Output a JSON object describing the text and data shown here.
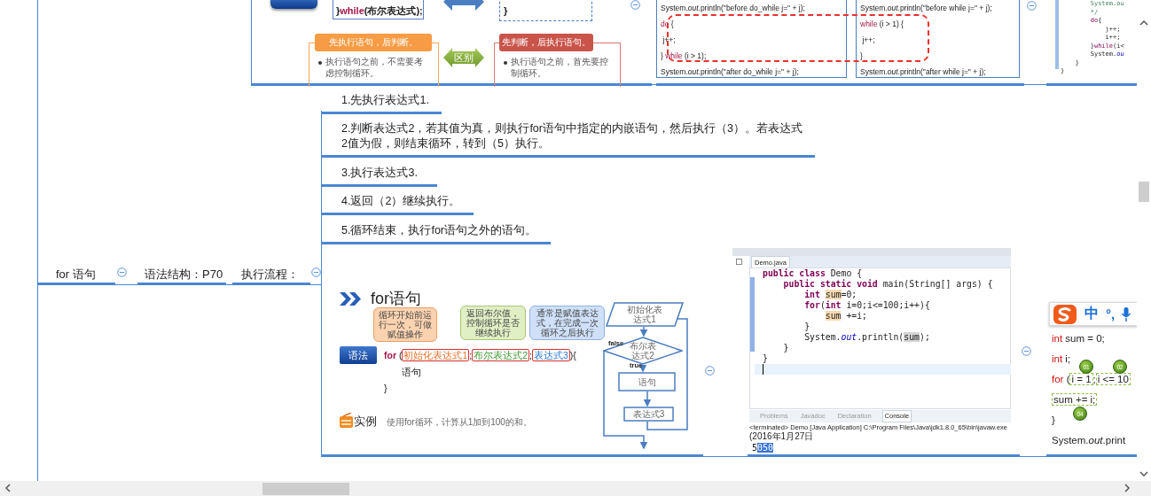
{
  "top_branch": {
    "loop_compare_slide": {
      "code_tail": [
        {
          "text": "}",
          "kind": "plain"
        },
        {
          "text": "while",
          "kind": "keyword"
        },
        {
          "text": "(布尔表达式);",
          "kind": "plain"
        }
      ],
      "block_end": "}",
      "do_while_heading": "先执行语句，后判断。",
      "do_while_note": "执行语句之前，不需要考虑控制循环。",
      "difference_label": "区别",
      "while_heading": "先判断，后执行语句。",
      "while_note": "执行语句之前，首先要控制循环。"
    },
    "code_compare": {
      "do_while_code": [
        [
          {
            "text": "System.",
            "kind": "plain"
          },
          {
            "text": "out",
            "kind": "italic"
          },
          {
            "text": ".println(\"before do_while j=\" + j);",
            "kind": "plain"
          }
        ],
        [
          {
            "text": "do",
            "kind": "keyword"
          },
          {
            "text": " {",
            "kind": "plain"
          }
        ],
        [
          {
            "text": " j++;",
            "kind": "plain"
          }
        ],
        [
          {
            "text": "} ",
            "kind": "plain"
          },
          {
            "text": "while",
            "kind": "keyword"
          },
          {
            "text": " (i > 1);",
            "kind": "plain"
          }
        ],
        [
          {
            "text": "System.",
            "kind": "plain"
          },
          {
            "text": "out",
            "kind": "italic"
          },
          {
            "text": ".println(\"after do_while j=\" + j);",
            "kind": "plain"
          }
        ]
      ],
      "while_code": [
        [
          {
            "text": "System.",
            "kind": "plain"
          },
          {
            "text": "out",
            "kind": "italic"
          },
          {
            "text": ".println(\"before while j=\" + j);",
            "kind": "plain"
          }
        ],
        [
          {
            "text": "while",
            "kind": "keyword"
          },
          {
            "text": " (i > 1) {",
            "kind": "plain"
          }
        ],
        [
          {
            "text": " j++;",
            "kind": "plain"
          }
        ],
        [
          {
            "text": "}",
            "kind": "plain"
          }
        ],
        [
          {
            "text": "System.",
            "kind": "plain"
          },
          {
            "text": "out",
            "kind": "italic"
          },
          {
            "text": ".println(\"after while j=\" + j);",
            "kind": "plain"
          }
        ]
      ]
    },
    "code_fragment": [
      [
        {
          "text": "        System.ou",
          "kind": "comment"
        }
      ],
      [
        {
          "text": "        */",
          "kind": "comment"
        }
      ],
      [
        {
          "text": "        do",
          "kind": "keyword"
        },
        {
          "text": "{",
          "kind": "plain"
        }
      ],
      [
        {
          "text": "            j++;",
          "kind": "plain"
        }
      ],
      [
        {
          "text": "            i++;",
          "kind": "plain"
        }
      ],
      [
        {
          "text": "        }",
          "kind": "plain"
        },
        {
          "text": "while",
          "kind": "keyword"
        },
        {
          "text": "(i<",
          "kind": "plain"
        }
      ],
      [
        {
          "text": "        System.",
          "kind": "plain"
        },
        {
          "text": "ou",
          "kind": "field"
        }
      ],
      [
        {
          "text": "    }",
          "kind": "plain"
        }
      ],
      [
        {
          "text": "}",
          "kind": "plain"
        }
      ]
    ]
  },
  "root": {
    "label": "for  语句"
  },
  "syntax": {
    "label": "语法结构：P70"
  },
  "flow": {
    "label": "执行流程：",
    "steps": [
      {
        "text": "1.先执行表达式1."
      },
      {
        "text": "2.判断表达式2，若其值为真，则执行for语句中指定的内嵌语句，然后执行（3）。若表达式2值为假，则结束循环，转到（5）执行。"
      },
      {
        "text": "3.执行表达式3."
      },
      {
        "text": "4.返回（2）继续执行。"
      },
      {
        "text": "5.循环结束，执行for语句之外的语句。"
      }
    ],
    "for_slide": {
      "title": "for语句",
      "callouts": [
        {
          "text": "循环开始前运行一次，可做赋值操作",
          "kind": "init"
        },
        {
          "text": "返回布尔值，控制循环是否继续执行",
          "kind": "cond"
        },
        {
          "text": "通常是赋值表达式，在完成一次循环之后执行",
          "kind": "step"
        }
      ],
      "syntax_button": "语法",
      "for_line": [
        {
          "text": "for",
          "kind": "keyword"
        },
        {
          "text": " (",
          "kind": "plain"
        },
        {
          "text": "初始化表达式1",
          "kind": "init"
        },
        {
          "text": ";",
          "kind": "plain"
        },
        {
          "text": "布尔表达式2",
          "kind": "cond"
        },
        {
          "text": ";",
          "kind": "plain"
        },
        {
          "text": "表达式3",
          "kind": "step"
        },
        {
          "text": "){",
          "kind": "plain"
        }
      ],
      "body": "语句",
      "close": "}",
      "example_label": "实例",
      "example_text": "使用for循环，计算从1加到100的和。",
      "flowchart": {
        "init": "初始化表达式1",
        "condition": "布尔表达式2",
        "false_label": "false",
        "true_label": "true",
        "body": "语句",
        "update": "表达式3"
      }
    },
    "eclipse": {
      "editor_tab": "Demo.java",
      "code": [
        [
          {
            "text": "public class",
            "kind": "keyword"
          },
          {
            "text": " Demo {",
            "kind": "plain"
          }
        ],
        [
          {
            "text": "    public static void",
            "kind": "keyword"
          },
          {
            "text": " main(String[] args) {",
            "kind": "plain"
          }
        ],
        [
          {
            "text": "        int",
            "kind": "keyword"
          },
          {
            "text": " sum",
            "kind": "highlight"
          },
          {
            "text": "=0;",
            "kind": "plain"
          }
        ],
        [
          {
            "text": "        for",
            "kind": "keyword"
          },
          {
            "text": "(",
            "kind": "plain"
          },
          {
            "text": "int",
            "kind": "keyword"
          },
          {
            "text": " i=0;i<=100;i++){",
            "kind": "plain"
          }
        ],
        [
          {
            "text": "            sum",
            "kind": "highlight"
          },
          {
            "text": " +=i;",
            "kind": "plain"
          }
        ],
        [
          {
            "text": "        }",
            "kind": "plain"
          }
        ],
        [
          {
            "text": "        System.",
            "kind": "plain"
          },
          {
            "text": "out",
            "kind": "field"
          },
          {
            "text": ".println(",
            "kind": "plain"
          },
          {
            "text": "sum",
            "kind": "reference"
          },
          {
            "text": ");",
            "kind": "plain"
          }
        ],
        [
          {
            "text": "    }",
            "kind": "plain"
          }
        ],
        [
          {
            "text": "}",
            "kind": "plain"
          }
        ]
      ],
      "console_tabs": [
        {
          "label": "Problems",
          "selected": false
        },
        {
          "label": "Javadoc",
          "selected": false
        },
        {
          "label": "Declaration",
          "selected": false
        },
        {
          "label": "Console",
          "selected": true
        }
      ],
      "status_line": "<terminated> Demo [Java Application] C:\\Program Files\\Java\\jdk1.8.0_65\\bin\\javaw.exe",
      "launch_time": "(2016年1月27日",
      "output": [
        {
          "text": "5",
          "kind": "plain"
        },
        {
          "text": "050",
          "kind": "selection"
        }
      ]
    },
    "example_slide": {
      "code": [
        [
          {
            "text": "int",
            "kind": "keyword"
          },
          {
            "text": " sum = 0;",
            "kind": "plain"
          }
        ],
        [
          {
            "text": "int",
            "kind": "keyword"
          },
          {
            "text": " i;",
            "kind": "plain"
          }
        ],
        [
          {
            "text": "for",
            "kind": "keyword"
          },
          {
            "text": " (",
            "kind": "plain"
          },
          {
            "text": "i = 1",
            "kind": "boxed"
          },
          {
            "text": ";",
            "kind": "plain"
          },
          {
            "text": "i <= 10",
            "kind": "boxed"
          }
        ],
        [
          {
            "text": "sum += i;",
            "kind": "boxed"
          }
        ],
        [
          {
            "text": "}",
            "kind": "plain"
          }
        ],
        [
          {
            "text": "System.",
            "kind": "plain"
          },
          {
            "text": "out",
            "kind": "italic"
          },
          {
            "text": ".print",
            "kind": "plain"
          }
        ]
      ],
      "step_badges": [
        {
          "label": "01"
        },
        {
          "label": "02"
        },
        {
          "label": "04"
        }
      ]
    }
  },
  "ime_toolbar": {
    "mode": "中",
    "punctuation": "°,"
  }
}
